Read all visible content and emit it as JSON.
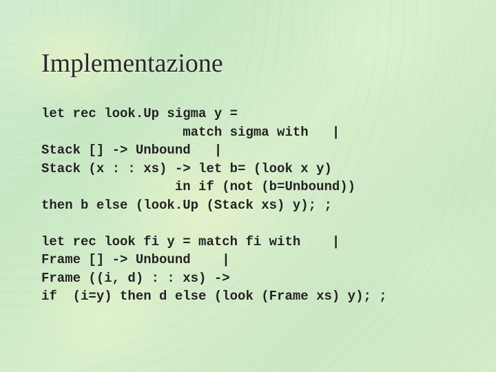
{
  "slide": {
    "title": "Implementazione",
    "code1": "let rec look.Up sigma y =\n                  match sigma with   |\nStack [] -> Unbound   |\nStack (x : : xs) -> let b= (look x y)\n                 in if (not (b=Unbound))\nthen b else (look.Up (Stack xs) y); ;",
    "code2": "let rec look fi y = match fi with    |\nFrame [] -> Unbound    |\nFrame ((i, d) : : xs) ->\nif  (i=y) then d else (look (Frame xs) y); ;"
  }
}
